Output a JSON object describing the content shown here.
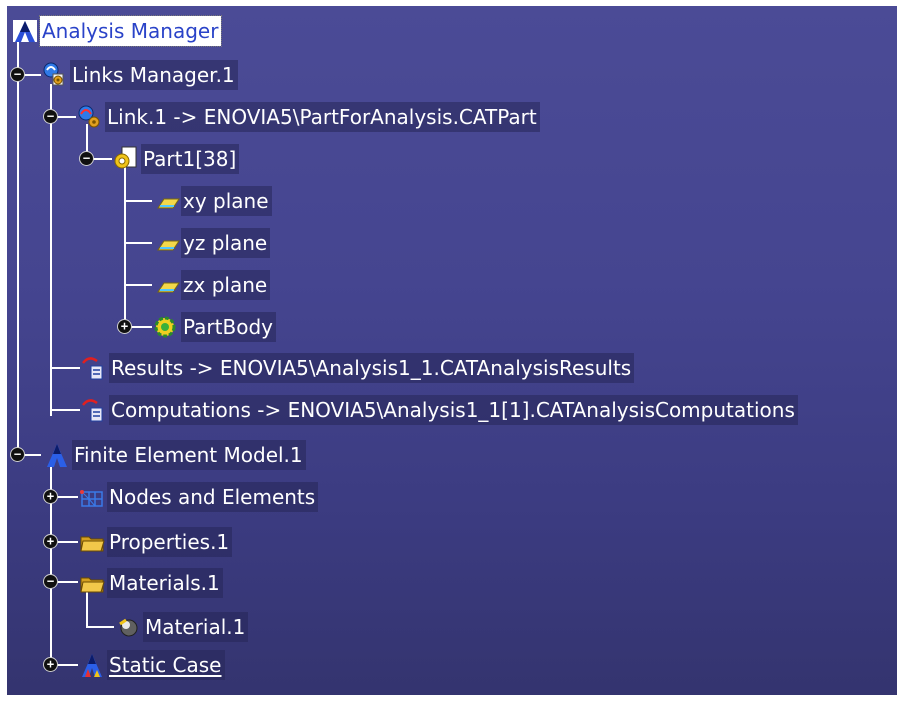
{
  "colors": {
    "background": "#41418a",
    "connector": "#ffffff",
    "selected_text": "#2a43c8"
  },
  "tree": {
    "root": {
      "label": "Analysis Manager",
      "icon": "analysis-manager-icon",
      "selected": true
    },
    "links_manager": {
      "label": "Links Manager.1",
      "icon": "links-manager-icon",
      "expanded": true
    },
    "link1": {
      "label": "Link.1 -> ENOVIA5\\PartForAnalysis.CATPart",
      "icon": "link-icon",
      "expanded": true
    },
    "part1": {
      "label": "Part1[38]",
      "icon": "part-document-icon",
      "expanded": true
    },
    "xy_plane": {
      "label": "xy plane",
      "icon": "plane-icon"
    },
    "yz_plane": {
      "label": "yz plane",
      "icon": "plane-icon"
    },
    "zx_plane": {
      "label": "zx plane",
      "icon": "plane-icon"
    },
    "part_body": {
      "label": "PartBody",
      "icon": "part-body-icon",
      "expanded": false
    },
    "results": {
      "label": "Results -> ENOVIA5\\Analysis1_1.CATAnalysisResults",
      "icon": "results-link-icon"
    },
    "computations": {
      "label": "Computations -> ENOVIA5\\Analysis1_1[1].CATAnalysisComputations",
      "icon": "computations-link-icon"
    },
    "fem": {
      "label": "Finite Element Model.1",
      "icon": "finite-element-model-icon",
      "expanded": true
    },
    "nodes_elements": {
      "label": "Nodes and Elements",
      "icon": "mesh-icon",
      "expanded": false
    },
    "properties": {
      "label": "Properties.1",
      "icon": "folder-icon",
      "expanded": false
    },
    "materials": {
      "label": "Materials.1",
      "icon": "folder-open-icon",
      "expanded": true
    },
    "material1": {
      "label": "Material.1",
      "icon": "material-sphere-icon"
    },
    "static_case": {
      "label": "Static Case",
      "icon": "static-case-icon",
      "expanded": false
    }
  }
}
